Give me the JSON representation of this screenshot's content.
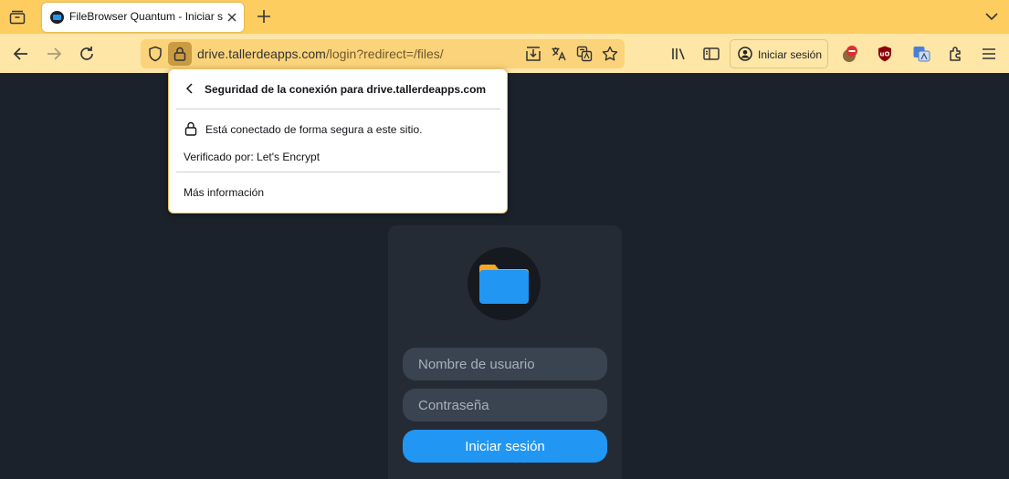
{
  "tab": {
    "title": "FileBrowser Quantum - Iniciar se"
  },
  "urlbar": {
    "host": "drive.tallerdeapps.com",
    "path": "/login?redirect=/files/"
  },
  "account": {
    "label": "Iniciar sesión"
  },
  "security_popup": {
    "title": "Seguridad de la conexión para drive.tallerdeapps.com",
    "secure_text": "Está conectado de forma segura a este sitio.",
    "verified_text": "Verificado por: Let's Encrypt",
    "more_info": "Más información"
  },
  "login": {
    "username_placeholder": "Nombre de usuario",
    "password_placeholder": "Contraseña",
    "submit_label": "Iniciar sesión"
  },
  "colors": {
    "tabstrip": "#fdcd60",
    "navbar": "#fde6a6",
    "page_bg": "#1c222b",
    "accent": "#2196f3"
  }
}
